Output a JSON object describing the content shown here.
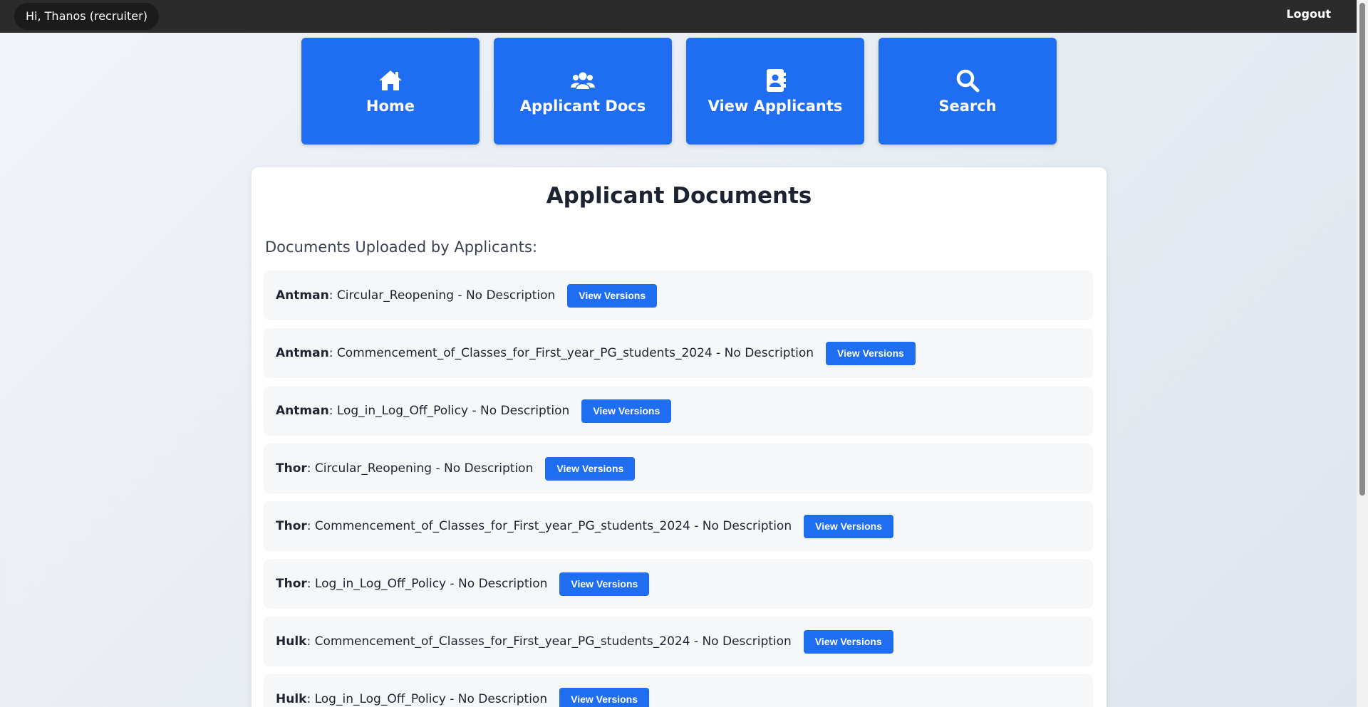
{
  "header": {
    "greeting": "Hi, Thanos (recruiter)",
    "logout_label": "Logout"
  },
  "nav": [
    {
      "label": "Home",
      "icon": "home-icon"
    },
    {
      "label": "Applicant Docs",
      "icon": "users-icon"
    },
    {
      "label": "View Applicants",
      "icon": "address-book-icon"
    },
    {
      "label": "Search",
      "icon": "search-icon"
    }
  ],
  "main": {
    "title": "Applicant Documents",
    "section_title": "Documents Uploaded by Applicants:",
    "documents": [
      {
        "applicant": "Antman",
        "detail": ": Circular_Reopening - No Description",
        "button": "View Versions"
      },
      {
        "applicant": "Antman",
        "detail": ": Commencement_of_Classes_for_First_year_PG_students_2024 - No Description",
        "button": "View Versions"
      },
      {
        "applicant": "Antman",
        "detail": ": Log_in_Log_Off_Policy - No Description",
        "button": "View Versions"
      },
      {
        "applicant": "Thor",
        "detail": ": Circular_Reopening - No Description",
        "button": "View Versions"
      },
      {
        "applicant": "Thor",
        "detail": ": Commencement_of_Classes_for_First_year_PG_students_2024 - No Description",
        "button": "View Versions"
      },
      {
        "applicant": "Thor",
        "detail": ": Log_in_Log_Off_Policy - No Description",
        "button": "View Versions"
      },
      {
        "applicant": "Hulk",
        "detail": ": Commencement_of_Classes_for_First_year_PG_students_2024 - No Description",
        "button": "View Versions"
      },
      {
        "applicant": "Hulk",
        "detail": ": Log_in_Log_Off_Policy - No Description",
        "button": "View Versions"
      }
    ]
  },
  "colors": {
    "accent": "#1f6df0",
    "topbar": "#2b2b2b"
  }
}
